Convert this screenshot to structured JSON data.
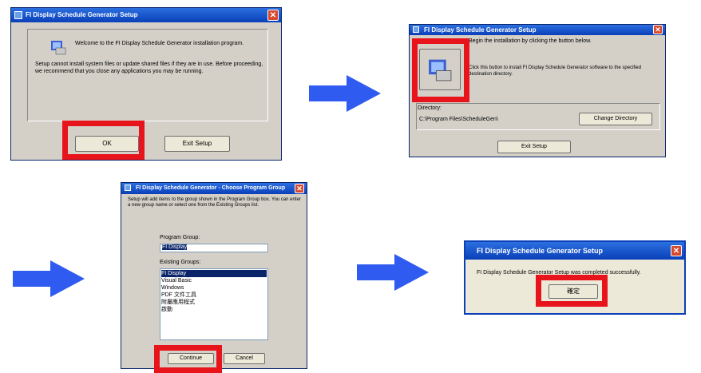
{
  "win1": {
    "title": "FI Display Schedule Generator Setup",
    "welcome": "Welcome to the FI Display Schedule Generator installation program.",
    "message": "Setup cannot install system files or update shared files if they are in use. Before proceeding, we recommend that you close any applications you may be running.",
    "ok_label": "OK",
    "exit_label": "Exit Setup"
  },
  "win2": {
    "title": "FI Display Schedule Generator Setup",
    "instruction": "Begin the installation by clicking the button below.",
    "install_desc": "Click this button to install FI Display Schedule Generator software to the specified destination directory.",
    "dir_label": "Directory:",
    "dir_value": "C:\\Program Files\\ScheduleGen\\",
    "change_dir_label": "Change Directory",
    "exit_label": "Exit Setup"
  },
  "win3": {
    "title": "FI Display Schedule Generator - Choose Program Group",
    "message": "Setup will add items to the group shown in the Program Group box. You can enter a new group name or select one from the Existing Groups list.",
    "program_group_label": "Program Group:",
    "program_group_value": "FI Display",
    "existing_groups_label": "Existing Groups:",
    "existing_groups": [
      "FI Display",
      "Visual Basic",
      "Windows",
      "PDF 文件工具",
      "附屬應用程式",
      "啟動"
    ],
    "continue_label": "Continue",
    "cancel_label": "Cancel"
  },
  "win4": {
    "title": "FI Display Schedule Generator Setup",
    "message": "FI Display Schedule Generator Setup was completed successfully.",
    "ok_label": "確定"
  },
  "colors": {
    "highlight": "#e8141c",
    "arrow": "#2f5bf0",
    "titlebar": "#0a3fb8"
  },
  "icons": [
    "installer-icon",
    "close-icon",
    "arrow-right-icon"
  ]
}
